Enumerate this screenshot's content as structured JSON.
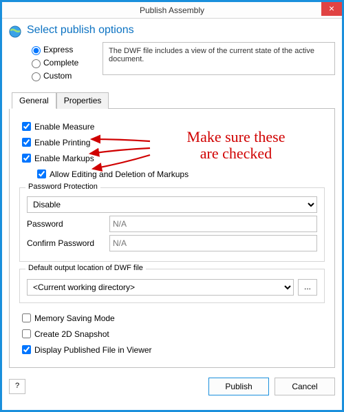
{
  "window": {
    "title": "Publish Assembly",
    "close_icon": "×"
  },
  "header": {
    "title": "Select publish options"
  },
  "radios": {
    "express": "Express",
    "complete": "Complete",
    "custom": "Custom"
  },
  "description": "The DWF file includes a view of the current state of the active document.",
  "tabs": {
    "general": "General",
    "properties": "Properties"
  },
  "checks": {
    "measure": "Enable Measure",
    "printing": "Enable Printing",
    "markups": "Enable Markups",
    "allow_edit": "Allow Editing and Deletion of Markups"
  },
  "password": {
    "legend": "Password Protection",
    "selected": "Disable",
    "pw_label": "Password",
    "cpw_label": "Confirm Password",
    "na": "N/A"
  },
  "output": {
    "legend": "Default output location of DWF file",
    "selected": "<Current working directory>",
    "browse": "..."
  },
  "bottom": {
    "memory": "Memory Saving Mode",
    "snapshot": "Create 2D Snapshot",
    "display": "Display Published File in Viewer"
  },
  "icon_btn": "?",
  "buttons": {
    "publish": "Publish",
    "cancel": "Cancel"
  },
  "annotation": {
    "line1": "Make sure these",
    "line2": "are checked"
  }
}
